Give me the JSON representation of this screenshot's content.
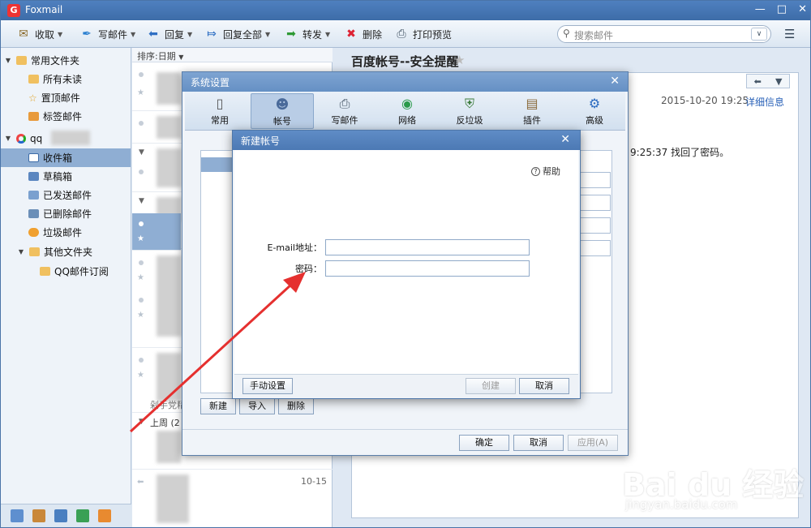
{
  "app": {
    "title": "Foxmail",
    "window_buttons": [
      "—",
      "□",
      "✕"
    ]
  },
  "toolbar": {
    "receive": "收取",
    "compose": "写邮件",
    "reply": "回复",
    "reply_all": "回复全部",
    "forward": "转发",
    "delete": "删除",
    "print_preview": "打印预览",
    "search_placeholder": "搜索邮件"
  },
  "sidebar": {
    "common_folders": "常用文件夹",
    "items": [
      "所有未读",
      "置顶邮件",
      "标签邮件"
    ],
    "account": "qq",
    "account_items": [
      "收件箱",
      "草稿箱",
      "已发送邮件",
      "已删除邮件",
      "垃圾邮件"
    ],
    "other_folders": "其他文件夹",
    "sub": "QQ邮件订阅"
  },
  "list": {
    "sort_label": "排序:日期",
    "date_last": "10-15",
    "fragment_1": "剁手党精",
    "fragment_2": "上周 (2"
  },
  "reader": {
    "subject": "百度帐号--安全提醒",
    "date": "2015-10-20 19:25",
    "detail_link": "详细信息",
    "body_text": "9:25:37 找回了密码。"
  },
  "sys_dialog": {
    "title": "系统设置",
    "categories": [
      "常用",
      "帐号",
      "写邮件",
      "网络",
      "反垃圾",
      "插件",
      "高级"
    ],
    "selected_category": "帐号",
    "btn_new": "新建",
    "btn_import": "导入",
    "btn_delete": "删除",
    "btn_ok": "确定",
    "btn_cancel": "取消",
    "btn_apply": "应用(A)"
  },
  "new_account": {
    "title": "新建帐号",
    "help": "帮助",
    "email_label": "E-mail地址：",
    "password_label": "密码：",
    "email_value": "",
    "password_value": "",
    "btn_manual": "手动设置",
    "btn_create": "创建",
    "btn_cancel": "取消"
  },
  "watermark": {
    "big": "Bai du 经验",
    "small": "jingyan.baidu.com"
  },
  "colors": {
    "titlebar": "#4a7bbd",
    "selection": "#8faed3",
    "arrow": "#e5302f",
    "link": "#2a62b8"
  }
}
